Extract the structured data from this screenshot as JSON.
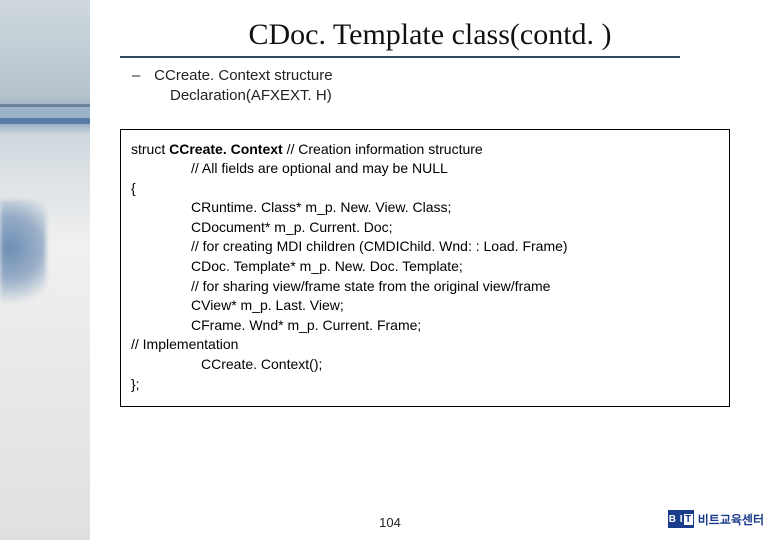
{
  "title": "CDoc. Template class(contd. )",
  "bullet": {
    "dash": "–",
    "line1": "CCreate. Context structure",
    "line2": "Declaration(AFXEXT. H)"
  },
  "code": {
    "struct_kw": "struct ",
    "struct_name": "CCreate. Context",
    "struct_tail": "   // Creation information structure",
    "comment_all_fields": "// All fields are optional and may be NULL",
    "open_brace": "{",
    "lines": [
      "CRuntime. Class* m_p. New. View. Class;",
      "CDocument* m_p. Current. Doc;",
      "// for creating MDI children (CMDIChild. Wnd: : Load. Frame)",
      "CDoc. Template* m_p. New. Doc. Template;",
      "// for sharing view/frame state from the original view/frame",
      "CView* m_p. Last. View;",
      "CFrame. Wnd* m_p. Current. Frame;"
    ],
    "impl_comment": "// Implementation",
    "ctor": "CCreate. Context();",
    "close_brace": "};"
  },
  "page_number": "104",
  "footer": {
    "logo_text_1": "B I",
    "logo_text_2": "T",
    "label": "비트교육센터"
  }
}
